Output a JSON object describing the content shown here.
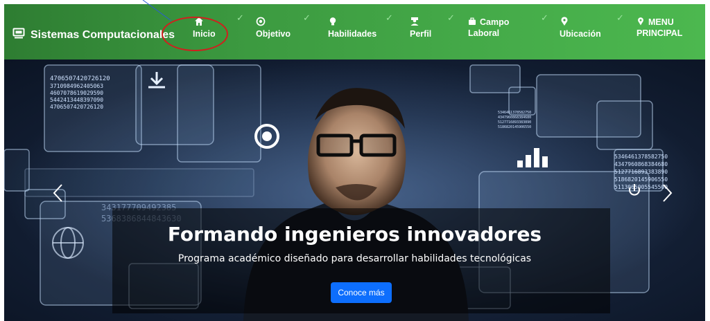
{
  "brand": {
    "label": "Sistemas Computacionales",
    "icon": "monitor-icon"
  },
  "nav": {
    "items": [
      {
        "label": "Inicio",
        "icon": "home-icon"
      },
      {
        "label": "Objetivo",
        "icon": "target-icon"
      },
      {
        "label": "Habilidades",
        "icon": "lightbulb-icon"
      },
      {
        "label": "Perfil",
        "icon": "user-tie-icon"
      },
      {
        "label": "Campo",
        "label2": "Laboral",
        "icon": "briefcase-icon"
      },
      {
        "label": "Ubicación",
        "icon": "map-pin-icon"
      },
      {
        "label": "MENU",
        "label2": "PRINCIPAL",
        "icon": "map-pin-icon"
      }
    ]
  },
  "hero": {
    "title": "Formando ingenieros innovadores",
    "subtitle": "Programa académico diseñado para desarrollar habilidades tecnológicas",
    "cta_label": "Conoce más",
    "panel_numbers": [
      "4706507420726120",
      "3710984962405063",
      "4607078619029590",
      "5442413448397090",
      "4706507420726120"
    ],
    "side_numbers": [
      "5346461378582750",
      "4347960868384680",
      "5127716893383890",
      "5186820145906550",
      "5113065005545500"
    ],
    "big_numbers": [
      "343177709492385",
      "5368386844843630"
    ]
  },
  "colors": {
    "nav_start": "#2e7d32",
    "nav_end": "#4cb84f",
    "cta": "#0d6efd",
    "annotation": "#d21e1e"
  }
}
